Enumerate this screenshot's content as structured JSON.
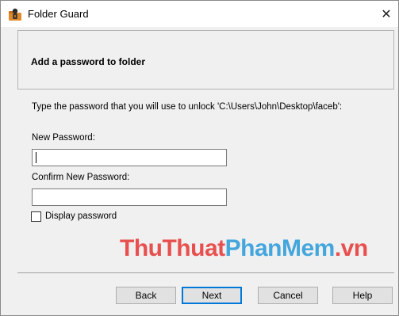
{
  "window": {
    "title": "Folder Guard",
    "close_glyph": "✕",
    "icon": "folder-guard-app-icon"
  },
  "header": {
    "title": "Add a password to folder"
  },
  "body": {
    "instruction": "Type the password that you will use to unlock 'C:\\Users\\John\\Desktop\\faceb':",
    "new_password_label": "New Password:",
    "new_password_value": "",
    "confirm_password_label": "Confirm New Password:",
    "confirm_password_value": "",
    "display_password_label": "Display password",
    "display_password_checked": false
  },
  "watermark": {
    "part1": "ThuThuat",
    "part2": "PhanMem",
    "part3": ".vn",
    "color_red": "#e8504f",
    "color_blue": "#43a6dd"
  },
  "buttons": {
    "back": "Back",
    "next": "Next",
    "cancel": "Cancel",
    "help": "Help"
  },
  "colors": {
    "accent": "#0078d7",
    "window_bg": "#f0f0f0"
  }
}
